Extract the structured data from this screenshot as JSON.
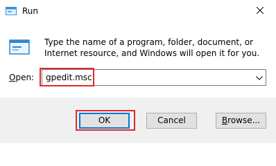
{
  "window": {
    "title": "Run",
    "app_icon": "run-dialog-icon",
    "close_icon": "close-icon"
  },
  "body": {
    "icon": "run-program-icon",
    "description": "Type the name of a program, folder, document, or Internet resource, and Windows will open it for you.",
    "open_label_mnemonic": "O",
    "open_label_rest": "pen:",
    "open_value": "gpedit.msc",
    "dropdown_icon": "chevron-down-icon"
  },
  "buttons": {
    "ok_label": "OK",
    "cancel_label": "Cancel",
    "browse_mnemonic": "B",
    "browse_rest": "rowse..."
  },
  "colors": {
    "highlight": "#e0292e",
    "default_button_border": "#0078d7",
    "footer_bg": "#f0f0f0"
  }
}
